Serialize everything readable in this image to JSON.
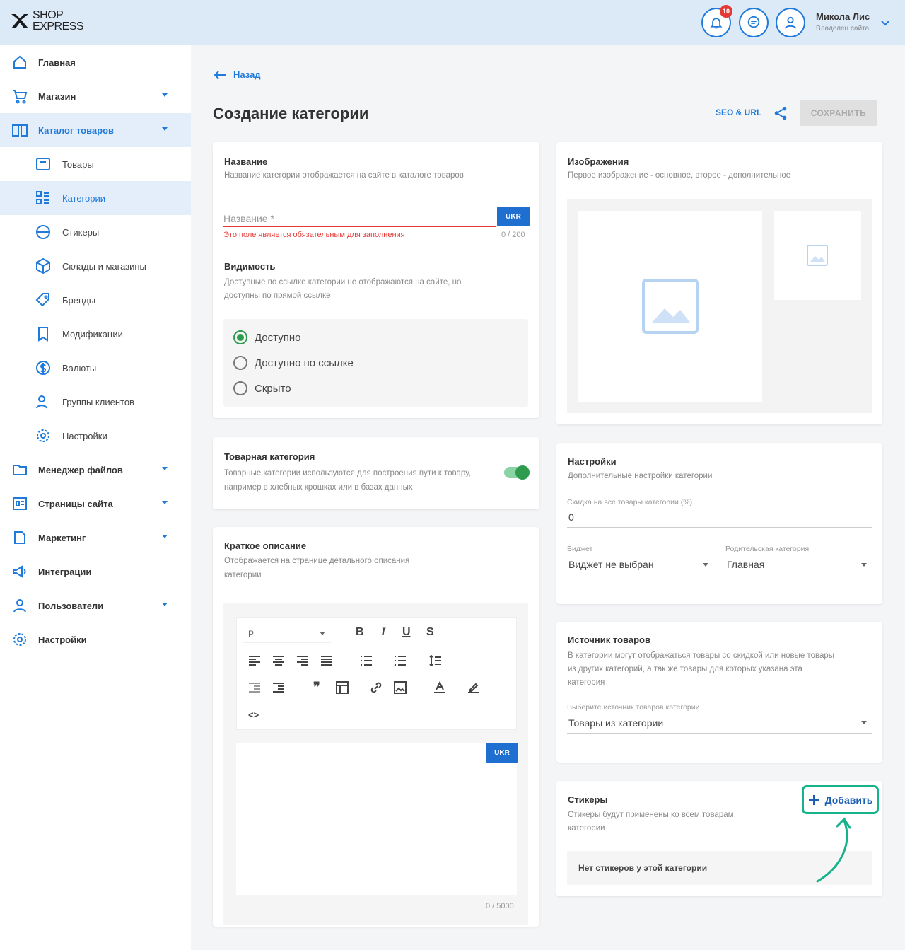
{
  "header": {
    "logo_line1": "SHOP",
    "logo_line2": "EXPRESS",
    "notification_count": "10",
    "user_name": "Микола Лис",
    "user_role": "Владелец сайта"
  },
  "sidebar": {
    "items": [
      {
        "label": "Главная",
        "icon": "home-icon"
      },
      {
        "label": "Магазин",
        "icon": "cart-icon"
      },
      {
        "label": "Каталог товаров",
        "icon": "book-icon"
      },
      {
        "label": "Товары",
        "icon": "box-icon"
      },
      {
        "label": "Категории",
        "icon": "list-icon"
      },
      {
        "label": "Стикеры",
        "icon": "sticker-icon"
      },
      {
        "label": "Склады и магазины",
        "icon": "warehouse-icon"
      },
      {
        "label": "Бренды",
        "icon": "tag-icon"
      },
      {
        "label": "Модификации",
        "icon": "bookmark-icon"
      },
      {
        "label": "Валюты",
        "icon": "currency-icon"
      },
      {
        "label": "Группы клиентов",
        "icon": "users-icon"
      },
      {
        "label": "Настройки",
        "icon": "gear-icon"
      },
      {
        "label": "Менеджер файлов",
        "icon": "folder-icon"
      },
      {
        "label": "Страницы сайта",
        "icon": "pages-icon"
      },
      {
        "label": "Маркетинг",
        "icon": "marketing-icon"
      },
      {
        "label": "Интеграции",
        "icon": "megaphone-icon"
      },
      {
        "label": "Пользователи",
        "icon": "user-icon"
      },
      {
        "label": "Настройки",
        "icon": "gear-icon"
      }
    ]
  },
  "main": {
    "back_label": "Назад",
    "title": "Создание категории",
    "seo_label": "SEO & URL",
    "save_label": "СОХРАНИТЬ"
  },
  "name_card": {
    "title": "Название",
    "subtitle": "Название категории отображается на сайте в каталоге товаров",
    "placeholder": "Название *",
    "lang": "UKR",
    "error": "Это поле является обязательным для заполнения",
    "counter": "0 / 200",
    "visibility_title": "Видимость",
    "visibility_sub_1": "Доступные по ссылке категории не отображаются на сайте, но",
    "visibility_sub_2": "доступны по прямой ссылке",
    "options": [
      "Доступно",
      "Доступно по ссылке",
      "Скрыто"
    ],
    "selected_option": "Доступно"
  },
  "product_category_card": {
    "title": "Товарная категория",
    "sub_1": "Товарные категории используются для построения пути к товару,",
    "sub_2": "например в хлебных крошках или в базах данных",
    "enabled": true
  },
  "description_card": {
    "title": "Краткое описание",
    "sub_1": "Отображается на странице детального описания",
    "sub_2": "категории",
    "format_value": "P",
    "lang": "UKR",
    "counter": "0 / 5000"
  },
  "images_card": {
    "title": "Изображения",
    "subtitle": "Первое изображение - основное, второе - дополнительное"
  },
  "settings_card": {
    "title": "Настройки",
    "subtitle": "Дополнительные настройки категории",
    "discount_label": "Скидка на все товары категории (%)",
    "discount_value": "0",
    "widget_label": "Виджет",
    "widget_value": "Виджет не выбран",
    "parent_label": "Родительская категория",
    "parent_value": "Главная"
  },
  "source_card": {
    "title": "Источник товаров",
    "sub_1": "В категории могут отображаться товары со скидкой или новые товары",
    "sub_2": "из других категорий, а так же товары для которых указана эта",
    "sub_3": "категория",
    "select_label": "Выберите источник товаров категории",
    "select_value": "Товары из категории"
  },
  "stickers_card": {
    "title": "Стикеры",
    "sub_1": "Стикеры будут применены ко всем товарам",
    "sub_2": "категории",
    "add_label": "Добавить",
    "empty_text": "Нет стикеров у этой категории"
  },
  "colors": {
    "accent": "#1f7ad9",
    "success": "#2e9b4e",
    "error": "#e53935",
    "highlight": "#16b38b"
  }
}
